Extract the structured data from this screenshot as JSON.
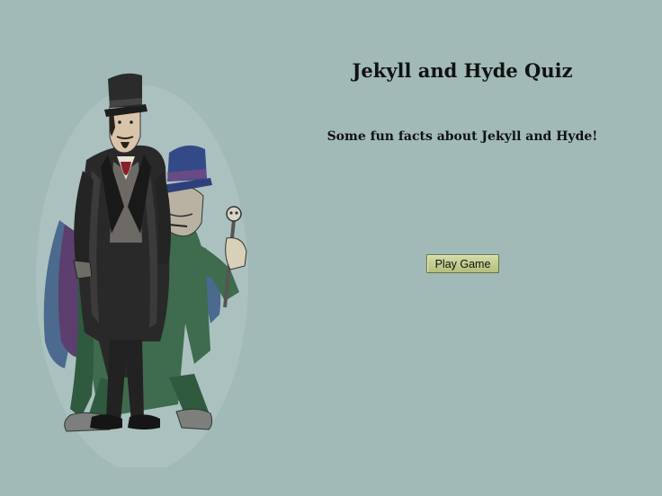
{
  "page": {
    "title": "Jekyll and Hyde Quiz",
    "subtitle": "Some fun facts about Jekyll and Hyde!"
  },
  "actions": {
    "play_label": "Play Game"
  },
  "illustration": {
    "subject": "jekyll-and-hyde-illustration"
  },
  "colors": {
    "background": "#a1bab8",
    "button": "#c2cc8e"
  }
}
